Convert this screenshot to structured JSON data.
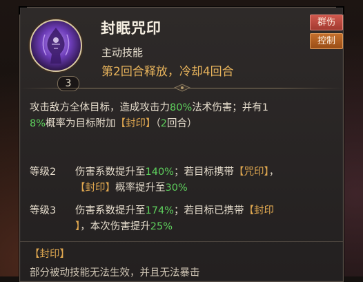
{
  "skill": {
    "name": "封眠咒印",
    "type": "主动技能",
    "cast_info": "第2回合释放，冷却4回合",
    "level": "3",
    "icon": "sealed-demon-icon",
    "tags": [
      "群伤",
      "控制"
    ]
  },
  "description": {
    "p1": "攻击敌方全体目标，造成攻击力",
    "dmg": "80%",
    "p2": "法术伤害；并有1",
    "rate": "8%",
    "p3": "概率为目标附加",
    "status": "【封印】",
    "p4": "（",
    "turns": "2",
    "p5": "回合）"
  },
  "upgrades": [
    {
      "label": "等级2",
      "t1": "伤害系数提升至",
      "v1": "140%",
      "t2": "；若目标携带",
      "s1": "【咒印】",
      "t3": "，",
      "s2": "【封印】",
      "t4": "概率提升至",
      "v2": "30%"
    },
    {
      "label": "等级3",
      "t1": "伤害系数提升至",
      "v1": "174%",
      "t2": "；若目标已携带",
      "s1": "【封印",
      "s1b": "】",
      "t3": "，本次伤害提升",
      "v2": "25%"
    }
  ],
  "status_effect": {
    "title": "【封印】",
    "desc": "部分被动技能无法生效，并且无法暴击"
  },
  "colors": {
    "highlight_green": "#5ed05d",
    "highlight_gold": "#e0a850",
    "tag_aoe": "#c4483d",
    "tag_control": "#b55f22"
  }
}
